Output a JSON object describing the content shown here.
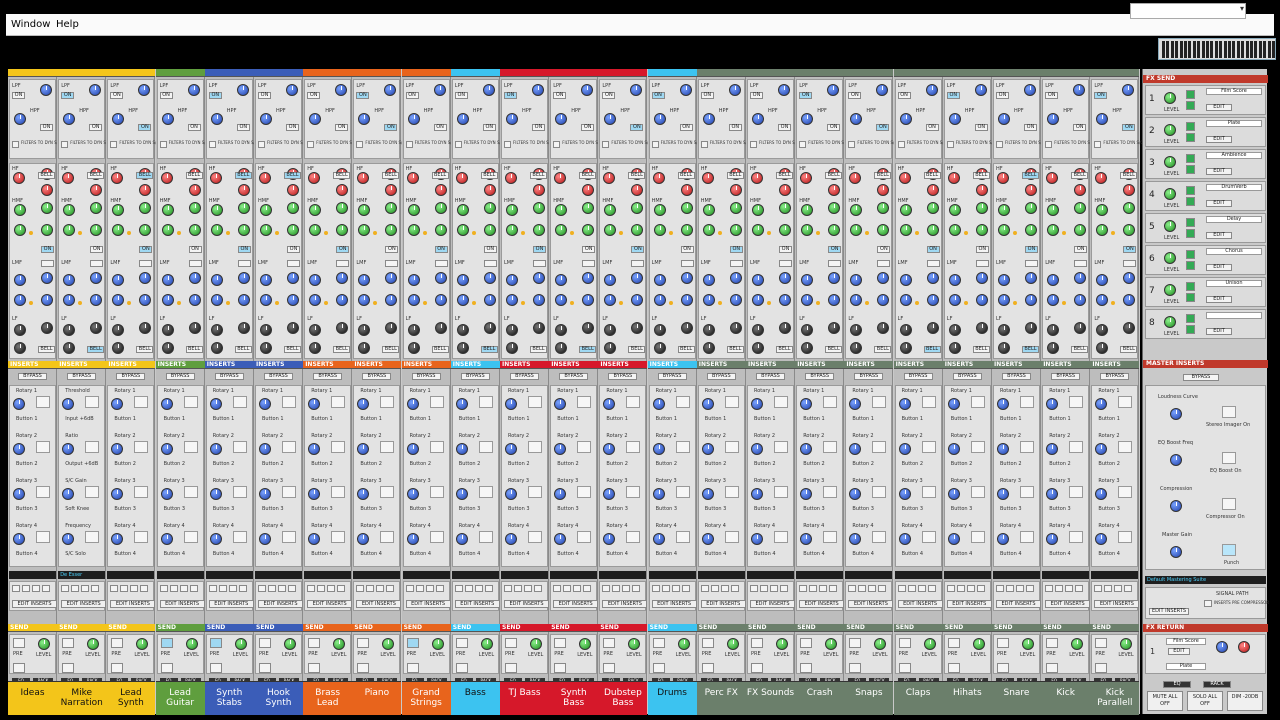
{
  "menu": {
    "window": "Window",
    "help": "Help"
  },
  "channels": [
    {
      "name": "Ideas",
      "color": "#f3c51a",
      "ins_left": "Rotary 1",
      "ins_b": "Button 1",
      "r2": "Rotary 2",
      "b2": "Button 2",
      "r3": "Rotary 3",
      "b3": "Button 3",
      "r4": "Rotary 4",
      "b4": "Button 4"
    },
    {
      "name": "Mike Narration",
      "color": "#f3c51a",
      "ins_left": "Threshold",
      "ins_b": "Input +6dB",
      "r2": "Ratio",
      "b2": "Output +6dB",
      "r3": "S/C Gain",
      "b3": "Soft Knee",
      "r4": "Frequency",
      "b4": "S/C Solo"
    },
    {
      "name": "Lead Synth",
      "color": "#f3c51a",
      "ins_left": "Rotary 1",
      "ins_b": "Button 1",
      "r2": "Rotary 2",
      "b2": "Button 2",
      "r3": "Rotary 3",
      "b3": "Button 3",
      "r4": "Rotary 4",
      "b4": "Button 4"
    },
    {
      "name": "Lead Guitar",
      "color": "#5f9e3e",
      "ins_left": "Rotary 1",
      "ins_b": "Button 1",
      "r2": "Rotary 2",
      "b2": "Button 2",
      "r3": "Rotary 3",
      "b3": "Button 3",
      "r4": "Rotary 4",
      "b4": "Button 4"
    },
    {
      "name": "Synth Stabs",
      "color": "#3b5db8",
      "ins_left": "Rotary 1",
      "ins_b": "Button 1",
      "r2": "Rotary 2",
      "b2": "Button 2",
      "r3": "Rotary 3",
      "b3": "Button 3",
      "r4": "Rotary 4",
      "b4": "Button 4"
    },
    {
      "name": "Hook Synth",
      "color": "#3b5db8",
      "ins_left": "Rotary 1",
      "ins_b": "Button 1",
      "r2": "Rotary 2",
      "b2": "Button 2",
      "r3": "Rotary 3",
      "b3": "Button 3",
      "r4": "Rotary 4",
      "b4": "Button 4"
    },
    {
      "name": "Brass Lead",
      "color": "#e8641c",
      "ins_left": "Rotary 1",
      "ins_b": "Button 1",
      "r2": "Rotary 2",
      "b2": "Button 2",
      "r3": "Rotary 3",
      "b3": "Button 3",
      "r4": "Rotary 4",
      "b4": "Button 4"
    },
    {
      "name": "Piano",
      "color": "#e8641c",
      "ins_left": "Rotary 1",
      "ins_b": "Button 1",
      "r2": "Rotary 2",
      "b2": "Button 2",
      "r3": "Rotary 3",
      "b3": "Button 3",
      "r4": "Rotary 4",
      "b4": "Button 4"
    },
    {
      "name": "Grand Strings",
      "color": "#e8641c",
      "ins_left": "Rotary 1",
      "ins_b": "Button 1",
      "r2": "Rotary 2",
      "b2": "Button 2",
      "r3": "Rotary 3",
      "b3": "Button 3",
      "r4": "Rotary 4",
      "b4": "Button 4"
    },
    {
      "name": "Bass",
      "color": "#3cc3f0",
      "ins_left": "Rotary 1",
      "ins_b": "Button 1",
      "r2": "Rotary 2",
      "b2": "Button 2",
      "r3": "Rotary 3",
      "b3": "Button 3",
      "r4": "Rotary 4",
      "b4": "Button 4"
    },
    {
      "name": "TJ Bass",
      "color": "#d6182a",
      "ins_left": "Rotary 1",
      "ins_b": "Button 1",
      "r2": "Rotary 2",
      "b2": "Button 2",
      "r3": "Rotary 3",
      "b3": "Button 3",
      "r4": "Rotary 4",
      "b4": "Button 4"
    },
    {
      "name": "Synth Bass",
      "color": "#d6182a",
      "ins_left": "Rotary 1",
      "ins_b": "Button 1",
      "r2": "Rotary 2",
      "b2": "Button 2",
      "r3": "Rotary 3",
      "b3": "Button 3",
      "r4": "Rotary 4",
      "b4": "Button 4"
    },
    {
      "name": "Dubstep Bass",
      "color": "#d6182a",
      "ins_left": "Rotary 1",
      "ins_b": "Button 1",
      "r2": "Rotary 2",
      "b2": "Button 2",
      "r3": "Rotary 3",
      "b3": "Button 3",
      "r4": "Rotary 4",
      "b4": "Button 4"
    },
    {
      "name": "Drums",
      "color": "#3cc3f0",
      "ins_left": "Rotary 1",
      "ins_b": "Button 1",
      "r2": "Rotary 2",
      "b2": "Button 2",
      "r3": "Rotary 3",
      "b3": "Button 3",
      "r4": "Rotary 4",
      "b4": "Button 4"
    },
    {
      "name": "Perc FX",
      "color": "#6b7f6b",
      "ins_left": "Rotary 1",
      "ins_b": "Button 1",
      "r2": "Rotary 2",
      "b2": "Button 2",
      "r3": "Rotary 3",
      "b3": "Button 3",
      "r4": "Rotary 4",
      "b4": "Button 4"
    },
    {
      "name": "FX Sounds",
      "color": "#6b7f6b",
      "ins_left": "Rotary 1",
      "ins_b": "Button 1",
      "r2": "Rotary 2",
      "b2": "Button 2",
      "r3": "Rotary 3",
      "b3": "Button 3",
      "r4": "Rotary 4",
      "b4": "Button 4"
    },
    {
      "name": "Crash",
      "color": "#6b7f6b",
      "ins_left": "Rotary 1",
      "ins_b": "Button 1",
      "r2": "Rotary 2",
      "b2": "Button 2",
      "r3": "Rotary 3",
      "b3": "Button 3",
      "r4": "Rotary 4",
      "b4": "Button 4"
    },
    {
      "name": "Snaps",
      "color": "#6b7f6b",
      "ins_left": "Rotary 1",
      "ins_b": "Button 1",
      "r2": "Rotary 2",
      "b2": "Button 2",
      "r3": "Rotary 3",
      "b3": "Button 3",
      "r4": "Rotary 4",
      "b4": "Button 4"
    },
    {
      "name": "Claps",
      "color": "#6b7f6b",
      "ins_left": "Rotary 1",
      "ins_b": "Button 1",
      "r2": "Rotary 2",
      "b2": "Button 2",
      "r3": "Rotary 3",
      "b3": "Button 3",
      "r4": "Rotary 4",
      "b4": "Button 4"
    },
    {
      "name": "Hihats",
      "color": "#6b7f6b",
      "ins_left": "Rotary 1",
      "ins_b": "Button 1",
      "r2": "Rotary 2",
      "b2": "Button 2",
      "r3": "Rotary 3",
      "b3": "Button 3",
      "r4": "Rotary 4",
      "b4": "Button 4"
    },
    {
      "name": "Snare",
      "color": "#6b7f6b",
      "ins_left": "Rotary 1",
      "ins_b": "Button 1",
      "r2": "Rotary 2",
      "b2": "Button 2",
      "r3": "Rotary 3",
      "b3": "Button 3",
      "r4": "Rotary 4",
      "b4": "Button 4"
    },
    {
      "name": "Kick",
      "color": "#6b7f6b",
      "ins_left": "Rotary 1",
      "ins_b": "Button 1",
      "r2": "Rotary 2",
      "b2": "Button 2",
      "r3": "Rotary 3",
      "b3": "Button 3",
      "r4": "Rotary 4",
      "b4": "Button 4"
    },
    {
      "name": "Kick Parallell",
      "color": "#6b7f6b",
      "ins_left": "Rotary 1",
      "ins_b": "Button 1",
      "r2": "Rotary 2",
      "b2": "Button 2",
      "r3": "Rotary 3",
      "b3": "Button 3",
      "r4": "Rotary 4",
      "b4": "Button 4"
    }
  ],
  "strip_labels": {
    "lpf": "LPF",
    "hpf": "HPF",
    "on": "ON",
    "filters_to": "FILTERS TO DYN S/C",
    "bell": "BELL",
    "hmf": "HMF",
    "lmf": "LMF",
    "lf": "LF",
    "hf": "HF",
    "inserts": "INSERTS",
    "bypass": "BYPASS",
    "edit_inserts": "EDIT INSERTS",
    "send": "SEND",
    "pre": "PRE",
    "level": "LEVEL",
    "eq": "EQ",
    "rack": "RACK"
  },
  "mike_insert_name": "De Esser",
  "fx_send": {
    "title": "FX SEND",
    "level": "LEVEL",
    "edit": "EDIT",
    "items": [
      {
        "num": "1",
        "name": "Film Score"
      },
      {
        "num": "2",
        "name": "Plate"
      },
      {
        "num": "3",
        "name": "Ambience"
      },
      {
        "num": "4",
        "name": "DrumVerb"
      },
      {
        "num": "5",
        "name": "Delay"
      },
      {
        "num": "6",
        "name": "Chorus"
      },
      {
        "num": "7",
        "name": "Unison"
      },
      {
        "num": "8",
        "name": ""
      }
    ]
  },
  "master_inserts": {
    "title": "MASTER INSERTS",
    "bypass": "BYPASS",
    "loudness": "Loudness Curve",
    "stereo_imager": "Stereo Imager On",
    "eq_boost_freq": "EQ Boost Freq",
    "eq_boost_on": "EQ Boost On",
    "compression": "Compression",
    "compressor_on": "Compressor On",
    "master_gain": "Master Gain",
    "punch": "Punch",
    "preset": "Default Mastering Suite",
    "signal_path": "SIGNAL PATH",
    "inserts_pre": "INSERTS PRE COMPRESSOR",
    "edit_inserts": "EDIT INSERTS"
  },
  "fx_return": {
    "title": "FX RETURN",
    "first": "Film Score",
    "second": "Plate",
    "edit": "EDIT",
    "num1": "1"
  },
  "master_bottom": {
    "eq": "EQ",
    "rack": "RACK",
    "mute_all_off": "MUTE ALL OFF",
    "solo_all_off": "SOLO ALL OFF",
    "dim": "DIM -20DB"
  }
}
